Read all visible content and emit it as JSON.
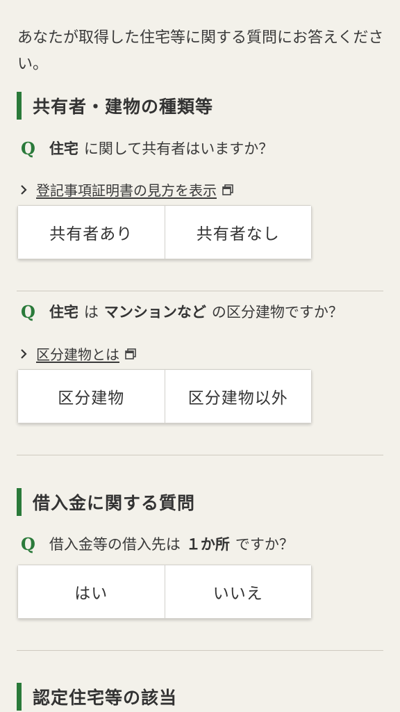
{
  "intro": "あなたが取得した住宅等に関する質問にお答えください。",
  "sections": {
    "building": {
      "title": "共有者・建物の種類等"
    },
    "loan": {
      "title": "借入金に関する質問"
    },
    "certified": {
      "title": "認定住宅等の該当"
    }
  },
  "q_mark": "Q",
  "q1": {
    "subject": "住宅",
    "text": "に関して共有者はいますか？",
    "link": "登記事項証明書の見方を表示",
    "link_icon": "external-window-icon",
    "options": [
      "共有者あり",
      "共有者なし"
    ]
  },
  "q2": {
    "subject": "住宅",
    "particle": "は",
    "highlight": "マンションなど",
    "text": "の区分建物ですか？",
    "link": "区分建物とは",
    "link_icon": "external-window-icon",
    "options": [
      "区分建物",
      "区分建物以外"
    ]
  },
  "q3": {
    "prefix": "借入金等の借入先は",
    "highlight": "１か所",
    "text": "ですか？",
    "options": [
      "はい",
      "いいえ"
    ]
  },
  "colors": {
    "accent": "#2a7a3a",
    "background": "#f3f1ea",
    "button": "#ffffff"
  }
}
